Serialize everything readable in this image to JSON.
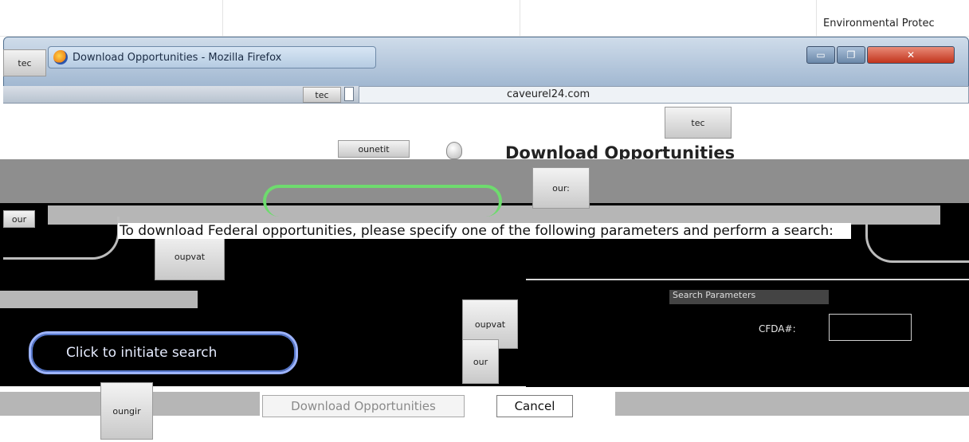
{
  "background_app": {
    "header_title": "Environmental Protec"
  },
  "window": {
    "title": "Download Opportunities - Mozilla Firefox",
    "address_text": "caveurel24.com",
    "controls": {
      "minimize": "▭",
      "maximize": "❐",
      "close": "✕"
    }
  },
  "thumbnails": {
    "t1": "tec",
    "t2": "tec",
    "t3": "ounetit",
    "t4": "our:",
    "t5": "our",
    "t6": "oupvat",
    "t7": "oupvat",
    "t8": "our",
    "t9": "oungir"
  },
  "page": {
    "title": "Download Opportunities",
    "instruction": "To download Federal opportunities, please specify one of the following parameters and perform a search:",
    "search_row_label": "Search Parameters",
    "field_label": "CFDA#:",
    "field_value": ""
  },
  "actions": {
    "search_button": "Click to initiate search",
    "download_button": "Download Opportunities",
    "cancel_button": "Cancel"
  }
}
